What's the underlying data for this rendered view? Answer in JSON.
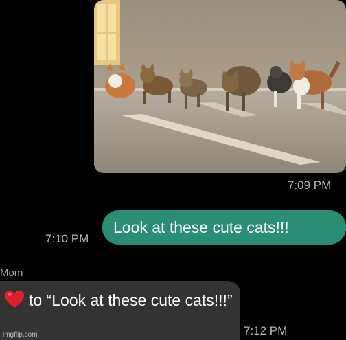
{
  "conversation": {
    "photo_message": {
      "icon": "cats-photo-image",
      "timestamp": "7:09 PM"
    },
    "outgoing_message": {
      "text": "Look at these cute cats!!!",
      "timestamp": "7:10 PM",
      "color": "#2a8e74"
    },
    "incoming_reaction": {
      "sender": "Mom",
      "icon": "red-heart-emoji",
      "text": "to “Look at these cute cats!!!”",
      "timestamp": "7:12 PM",
      "color": "#333333"
    }
  },
  "watermark": "imgflip.com"
}
